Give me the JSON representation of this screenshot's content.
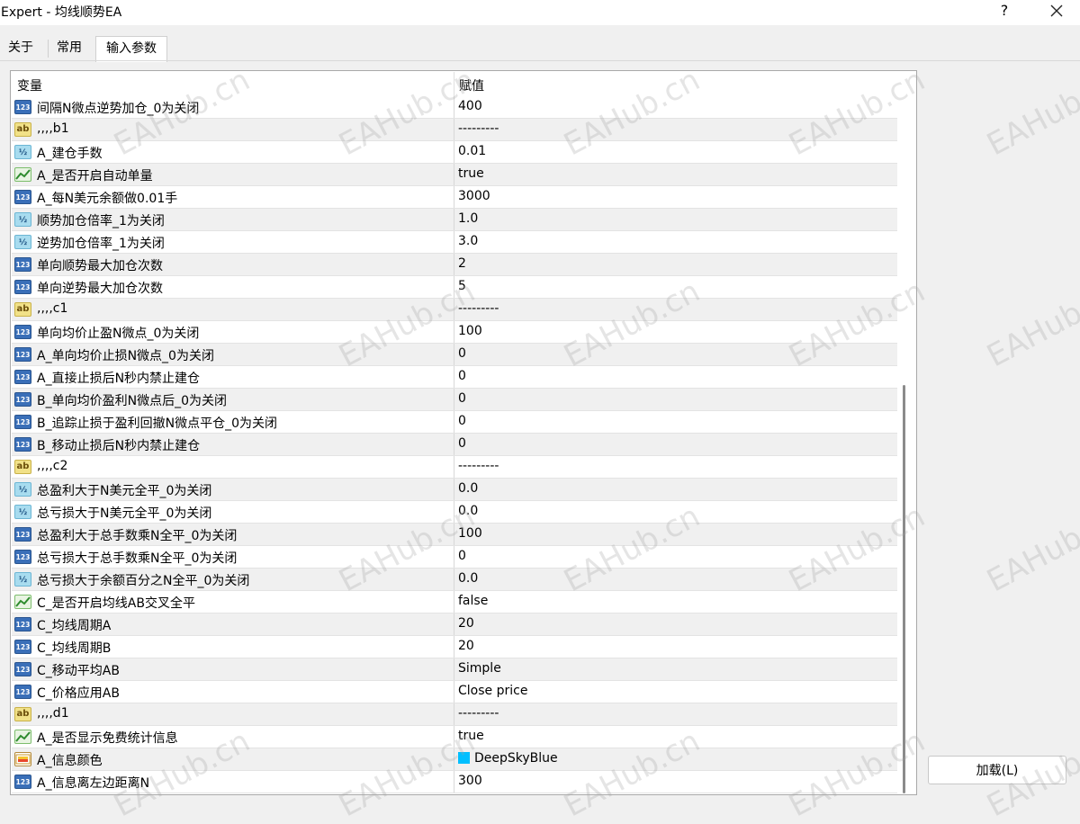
{
  "window": {
    "title": "Expert - 均线顺势EA",
    "help": "?"
  },
  "tabs": [
    {
      "label": "关于"
    },
    {
      "label": "常用"
    },
    {
      "label": "输入参数"
    }
  ],
  "grid": {
    "col_name": "变量",
    "col_value": "赋值",
    "rows": [
      {
        "type": "int",
        "name": "间隔N微点逆势加仓_0为关闭",
        "value": "400"
      },
      {
        "type": "str",
        "name": ",,,,b1",
        "value": "---------"
      },
      {
        "type": "dbl",
        "name": "A_建仓手数",
        "value": "0.01"
      },
      {
        "type": "bool",
        "name": "A_是否开启自动单量",
        "value": "true"
      },
      {
        "type": "int",
        "name": "A_每N美元余额做0.01手",
        "value": "3000"
      },
      {
        "type": "dbl",
        "name": "顺势加仓倍率_1为关闭",
        "value": "1.0"
      },
      {
        "type": "dbl",
        "name": "逆势加仓倍率_1为关闭",
        "value": "3.0"
      },
      {
        "type": "int",
        "name": "单向顺势最大加仓次数",
        "value": "2"
      },
      {
        "type": "int",
        "name": "单向逆势最大加仓次数",
        "value": "5"
      },
      {
        "type": "str",
        "name": ",,,,c1",
        "value": "---------"
      },
      {
        "type": "int",
        "name": "单向均价止盈N微点_0为关闭",
        "value": "100"
      },
      {
        "type": "int",
        "name": "A_单向均价止损N微点_0为关闭",
        "value": "0"
      },
      {
        "type": "int",
        "name": "A_直接止损后N秒内禁止建仓",
        "value": "0"
      },
      {
        "type": "int",
        "name": "B_单向均价盈利N微点后_0为关闭",
        "value": "0"
      },
      {
        "type": "int",
        "name": "B_追踪止损于盈利回撤N微点平仓_0为关闭",
        "value": "0"
      },
      {
        "type": "int",
        "name": "B_移动止损后N秒内禁止建仓",
        "value": "0"
      },
      {
        "type": "str",
        "name": ",,,,c2",
        "value": "---------"
      },
      {
        "type": "dbl",
        "name": "总盈利大于N美元全平_0为关闭",
        "value": "0.0"
      },
      {
        "type": "dbl",
        "name": "总亏损大于N美元全平_0为关闭",
        "value": "0.0"
      },
      {
        "type": "int",
        "name": "总盈利大于总手数乘N全平_0为关闭",
        "value": "100"
      },
      {
        "type": "int",
        "name": "总亏损大于总手数乘N全平_0为关闭",
        "value": "0"
      },
      {
        "type": "dbl",
        "name": "总亏损大于余额百分之N全平_0为关闭",
        "value": "0.0"
      },
      {
        "type": "bool",
        "name": "C_是否开启均线AB交叉全平",
        "value": "false"
      },
      {
        "type": "int",
        "name": "C_均线周期A",
        "value": "20"
      },
      {
        "type": "int",
        "name": "C_均线周期B",
        "value": "20"
      },
      {
        "type": "int",
        "name": "C_移动平均AB",
        "value": "Simple"
      },
      {
        "type": "int",
        "name": "C_价格应用AB",
        "value": "Close price"
      },
      {
        "type": "str",
        "name": ",,,,d1",
        "value": "---------"
      },
      {
        "type": "bool",
        "name": "A_是否显示免费统计信息",
        "value": "true"
      },
      {
        "type": "color",
        "name": "A_信息颜色",
        "value": "DeepSkyBlue",
        "swatch": "#00bfff"
      },
      {
        "type": "int",
        "name": "A_信息离左边距离N",
        "value": "300"
      }
    ]
  },
  "icon_labels": {
    "int": "123",
    "dbl": "½",
    "str": "ab"
  },
  "buttons": {
    "load": "加载(L)"
  },
  "watermark": "EAHub.cn"
}
